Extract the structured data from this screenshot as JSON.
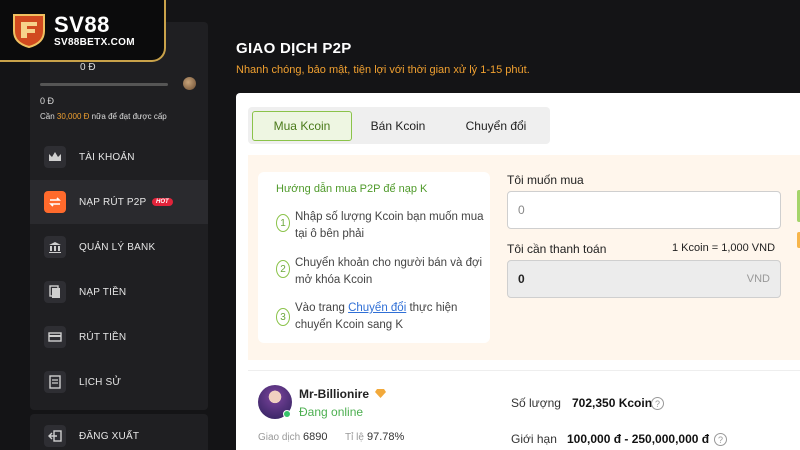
{
  "brand": {
    "name": "SV88",
    "domain": "SV88BETX.COM"
  },
  "sidebar": {
    "balance": "0 Đ",
    "balance_zero": "0 Đ",
    "need_prefix": "Cần",
    "need_amount": "30,000 Đ",
    "need_suffix": "nữa để đạt được cấp",
    "items": [
      {
        "label": "TÀI KHOẢN",
        "icon": "crown-icon"
      },
      {
        "label": "NẠP RÚT P2P",
        "icon": "exchange-icon",
        "badge": "HOT"
      },
      {
        "label": "QUẢN LÝ BANK",
        "icon": "bank-icon"
      },
      {
        "label": "NẠP TIỀN",
        "icon": "deposit-icon"
      },
      {
        "label": "RÚT TIỀN",
        "icon": "withdraw-icon"
      },
      {
        "label": "LỊCH SỬ",
        "icon": "history-icon"
      }
    ],
    "logout": "ĐĂNG XUẤT"
  },
  "main": {
    "title": "GIAO DỊCH P2P",
    "subtitle": "Nhanh chóng, bảo mật, tiện lợi với thời gian xử lý 1-15 phút.",
    "tabs": [
      "Mua Kcoin",
      "Bán Kcoin",
      "Chuyển đổi"
    ],
    "guide": {
      "title": "Hướng dẫn mua P2P để nạp K",
      "steps": [
        {
          "num": "1",
          "text": "Nhập số lượng Kcoin bạn muốn mua tại ô bên phải"
        },
        {
          "num": "2",
          "text": "Chuyển khoản cho người bán và đợi mở khóa Kcoin"
        },
        {
          "num": "3",
          "before": "Vào trang",
          "link": "Chuyển đổi",
          "after": "thực hiện chuyển Kcoin sang K"
        }
      ]
    },
    "form": {
      "want_buy_label": "Tôi muốn mua",
      "want_buy_placeholder": "0",
      "pay_label": "Tôi cần thanh toán",
      "rate": "1 Kcoin = 1,000 VND",
      "pay_value": "0",
      "pay_unit": "VND"
    },
    "seller": {
      "name": "Mr-Billionire",
      "status": "Đang online",
      "trades_label": "Giao dịch",
      "trades": "6890",
      "rate_label": "Tỉ lệ",
      "rate": "97.78%",
      "qty_label": "Số lượng",
      "qty": "702,350 Kcoin",
      "limit_label": "Giới hạn",
      "limit": "100,000 đ - 250,000,000 đ"
    }
  },
  "colors": {
    "accent": "#ff6a2c",
    "gold": "#f0a030",
    "green": "#8bc34a"
  }
}
